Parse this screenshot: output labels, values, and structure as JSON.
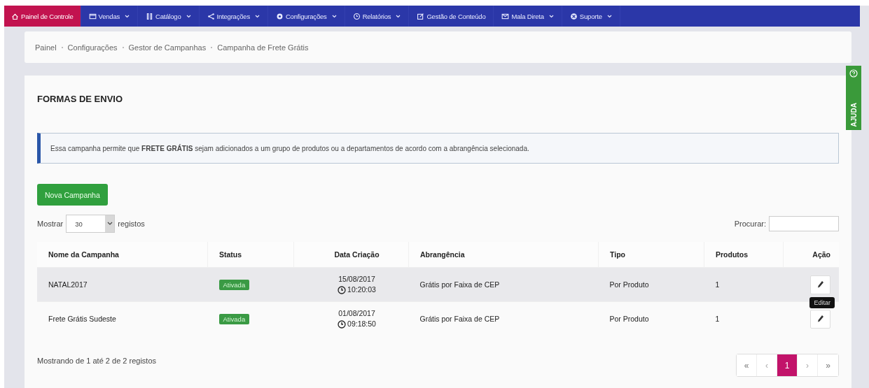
{
  "nav": [
    {
      "label": "Painel de Controle",
      "caret": false,
      "selected": true
    },
    {
      "label": "Vendas",
      "caret": true,
      "selected": false
    },
    {
      "label": "Catálogo",
      "caret": true,
      "selected": false
    },
    {
      "label": "Integrações",
      "caret": true,
      "selected": false
    },
    {
      "label": "Configurações",
      "caret": true,
      "selected": false
    },
    {
      "label": "Relatórios",
      "caret": true,
      "selected": false
    },
    {
      "label": "Gestão de Conteúdo",
      "caret": false,
      "selected": false
    },
    {
      "label": "Mala Direta",
      "caret": true,
      "selected": false
    },
    {
      "label": "Suporte",
      "caret": true,
      "selected": false
    }
  ],
  "breadcrumb": [
    "Painel",
    "Configurações",
    "Gestor de Campanhas",
    "Campanha de Frete Grátis"
  ],
  "help_tab": "AJUDA",
  "title": "FORMAS DE ENVIO",
  "alert": "Essa campanha permite que **FRETE GRÁTIS** sejam adicionados a um grupo de produtos ou a departamentos de acordo com a abrangência selecionada.",
  "new_button": "Nova Campanha",
  "length": {
    "before": "Mostrar",
    "value": "30",
    "after": "registos"
  },
  "search": {
    "label": "Procurar:"
  },
  "table": {
    "columns": [
      "Nome da Campanha",
      "Status",
      "Data Criação",
      "Abrangência",
      "Tipo",
      "Produtos",
      "Ação"
    ],
    "rows": [
      {
        "name": "NATAL2017",
        "status": "Ativada",
        "date": "15/08/2017",
        "time": "10:20:03",
        "scope": "Grátis por Faixa de CEP",
        "type": "Por Produto",
        "products": "1",
        "hovered": true,
        "tooltip": "Editar"
      },
      {
        "name": "Frete Grátis Sudeste",
        "status": "Ativada",
        "date": "01/08/2017",
        "time": "09:18:50",
        "scope": "Grátis por Faixa de CEP",
        "type": "Por Produto",
        "products": "1",
        "hovered": false
      }
    ]
  },
  "info": "Mostrando de 1 até 2 de 2 registos",
  "pagination": [
    {
      "kind": "first",
      "label": "«",
      "selected": false
    },
    {
      "kind": "prev",
      "label": "‹",
      "selected": false
    },
    {
      "kind": "page",
      "label": "1",
      "selected": true
    },
    {
      "kind": "next",
      "label": "›",
      "selected": false
    },
    {
      "kind": "last",
      "label": "»",
      "selected": false
    }
  ]
}
